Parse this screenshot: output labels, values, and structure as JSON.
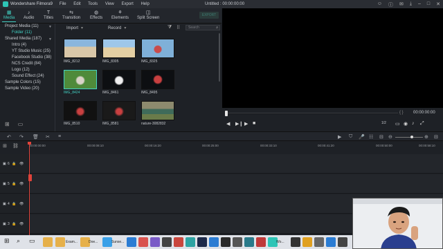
{
  "title_bar": {
    "app_name": "Wondershare Filmora9",
    "menu": [
      "File",
      "Edit",
      "Tools",
      "View",
      "Export",
      "Help"
    ],
    "project_title": "Untitled : 00:00:00:00"
  },
  "toolbar": {
    "tabs": [
      "Media",
      "Audio",
      "Titles",
      "Transition",
      "Effects",
      "Elements",
      "Split Screen"
    ],
    "active_tab": "Media",
    "export_label": "EXPORT"
  },
  "sidebar": {
    "items": [
      {
        "label": "Project Media (11)",
        "expanded": true
      },
      {
        "label": "Folder (11)",
        "selected": true
      },
      {
        "label": "Shared Media (187)",
        "expanded": true
      },
      {
        "label": "Intro (4)"
      },
      {
        "label": "YT Studio Music (25)"
      },
      {
        "label": "Facebook Studio (38)"
      },
      {
        "label": "NCS Credit (84)"
      },
      {
        "label": "Logo (12)"
      },
      {
        "label": "Sound Effect (24)"
      },
      {
        "label": "Sample Colors (15)"
      },
      {
        "label": "Sample Video (20)"
      }
    ]
  },
  "browser": {
    "import_label": "Import",
    "record_label": "Record",
    "search_placeholder": "Search",
    "items": [
      {
        "name": "IMG_8212"
      },
      {
        "name": "IMG_8305"
      },
      {
        "name": "IMG_8325"
      },
      {
        "name": "IMG_8424",
        "selected": true
      },
      {
        "name": "IMG_8461"
      },
      {
        "name": "IMG_8495"
      },
      {
        "name": "IMG_8510"
      },
      {
        "name": "IMG_8581"
      },
      {
        "name": "nature-3082832"
      }
    ]
  },
  "preview": {
    "timecode": "00:00:00:00",
    "ratio": "1/2"
  },
  "timeline": {
    "ruler_labels": [
      "00:00:00:00",
      "00:00:08:10",
      "00:00:16:20",
      "00:00:25:00",
      "00:00:33:10",
      "00:00:41:20",
      "00:00:50:00",
      "00:00:58:10"
    ],
    "tracks": [
      "6",
      "5",
      "4",
      "3"
    ]
  },
  "taskbar": {
    "items": [
      "Exam...",
      "Doe...",
      "Sunse...",
      "Wo..."
    ]
  }
}
